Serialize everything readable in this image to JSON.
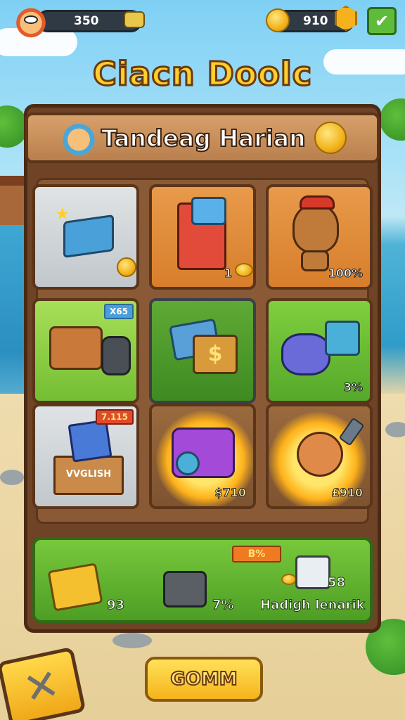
{
  "hud": {
    "player_score": "350",
    "currency": "910"
  },
  "title": "Ciacn Doolc",
  "banner": {
    "title": "Tandeag Harian"
  },
  "tiles": [
    {
      "label": "",
      "tag": "",
      "icon": "toolbox-icon"
    },
    {
      "label": "1",
      "tag": "",
      "icon": "robot-backpack-icon"
    },
    {
      "label": "100%",
      "tag": "",
      "icon": "monkey-character-icon"
    },
    {
      "label": "",
      "tag": "X65",
      "icon": "suitcase-binoculars-icon"
    },
    {
      "label": "",
      "tag": "",
      "icon": "cash-bundle-icon"
    },
    {
      "label": "3%",
      "tag": "",
      "icon": "treasure-pot-icon"
    },
    {
      "label": "",
      "tag": "7.115",
      "icon": "card-crate-icon",
      "crate_text": "VVGLISH"
    },
    {
      "label": "$710",
      "tag": "",
      "icon": "purple-camera-icon"
    },
    {
      "label": "£910",
      "tag": "",
      "icon": "flame-creature-icon"
    }
  ],
  "rewards": {
    "item1_value": "93",
    "item2_value": "7%",
    "tag": "B%",
    "item3_value": "58",
    "item3_label": "Hadigh lenarik"
  },
  "buttons": {
    "go": "GOMM"
  },
  "colors": {
    "title_yellow": "#ffcf2b",
    "panel_brown": "#6e4326",
    "reward_green": "#5fb52e",
    "button_yellow": "#f5b41a"
  }
}
